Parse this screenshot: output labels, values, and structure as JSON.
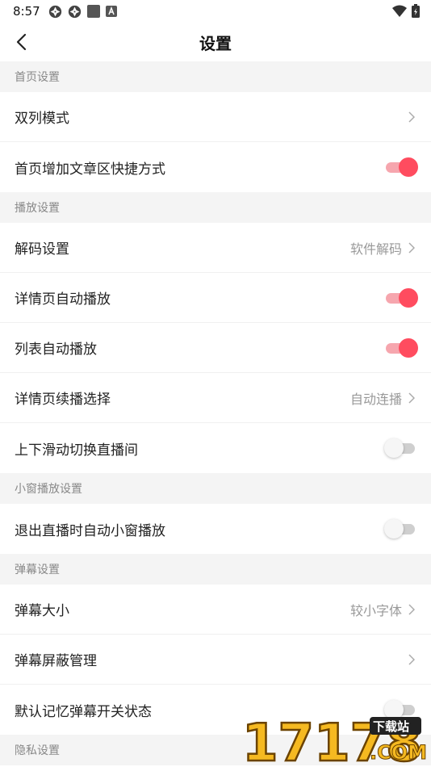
{
  "status_bar": {
    "time": "8:57"
  },
  "header": {
    "title": "设置"
  },
  "sections": [
    {
      "title": "首页设置",
      "rows": [
        {
          "label": "双列模式",
          "type": "nav",
          "value": ""
        },
        {
          "label": "首页增加文章区快捷方式",
          "type": "toggle",
          "on": true
        }
      ]
    },
    {
      "title": "播放设置",
      "rows": [
        {
          "label": "解码设置",
          "type": "nav",
          "value": "软件解码"
        },
        {
          "label": "详情页自动播放",
          "type": "toggle",
          "on": true
        },
        {
          "label": "列表自动播放",
          "type": "toggle",
          "on": true
        },
        {
          "label": "详情页续播选择",
          "type": "nav",
          "value": "自动连播"
        },
        {
          "label": "上下滑动切换直播间",
          "type": "toggle",
          "on": false
        }
      ]
    },
    {
      "title": "小窗播放设置",
      "rows": [
        {
          "label": "退出直播时自动小窗播放",
          "type": "toggle",
          "on": false
        }
      ]
    },
    {
      "title": "弹幕设置",
      "rows": [
        {
          "label": "弹幕大小",
          "type": "nav",
          "value": "较小字体"
        },
        {
          "label": "弹幕屏蔽管理",
          "type": "nav",
          "value": ""
        },
        {
          "label": "默认记忆弹幕开关状态",
          "type": "toggle",
          "on": false
        }
      ]
    },
    {
      "title": "隐私设置",
      "rows": []
    }
  ],
  "watermark": {
    "number": "17178",
    "tag": "下载站",
    "domain": ".COM"
  },
  "colors": {
    "accent": "#ff4c5f",
    "accent_light": "#f6a6ae",
    "section_bg": "#f4f4f4"
  }
}
